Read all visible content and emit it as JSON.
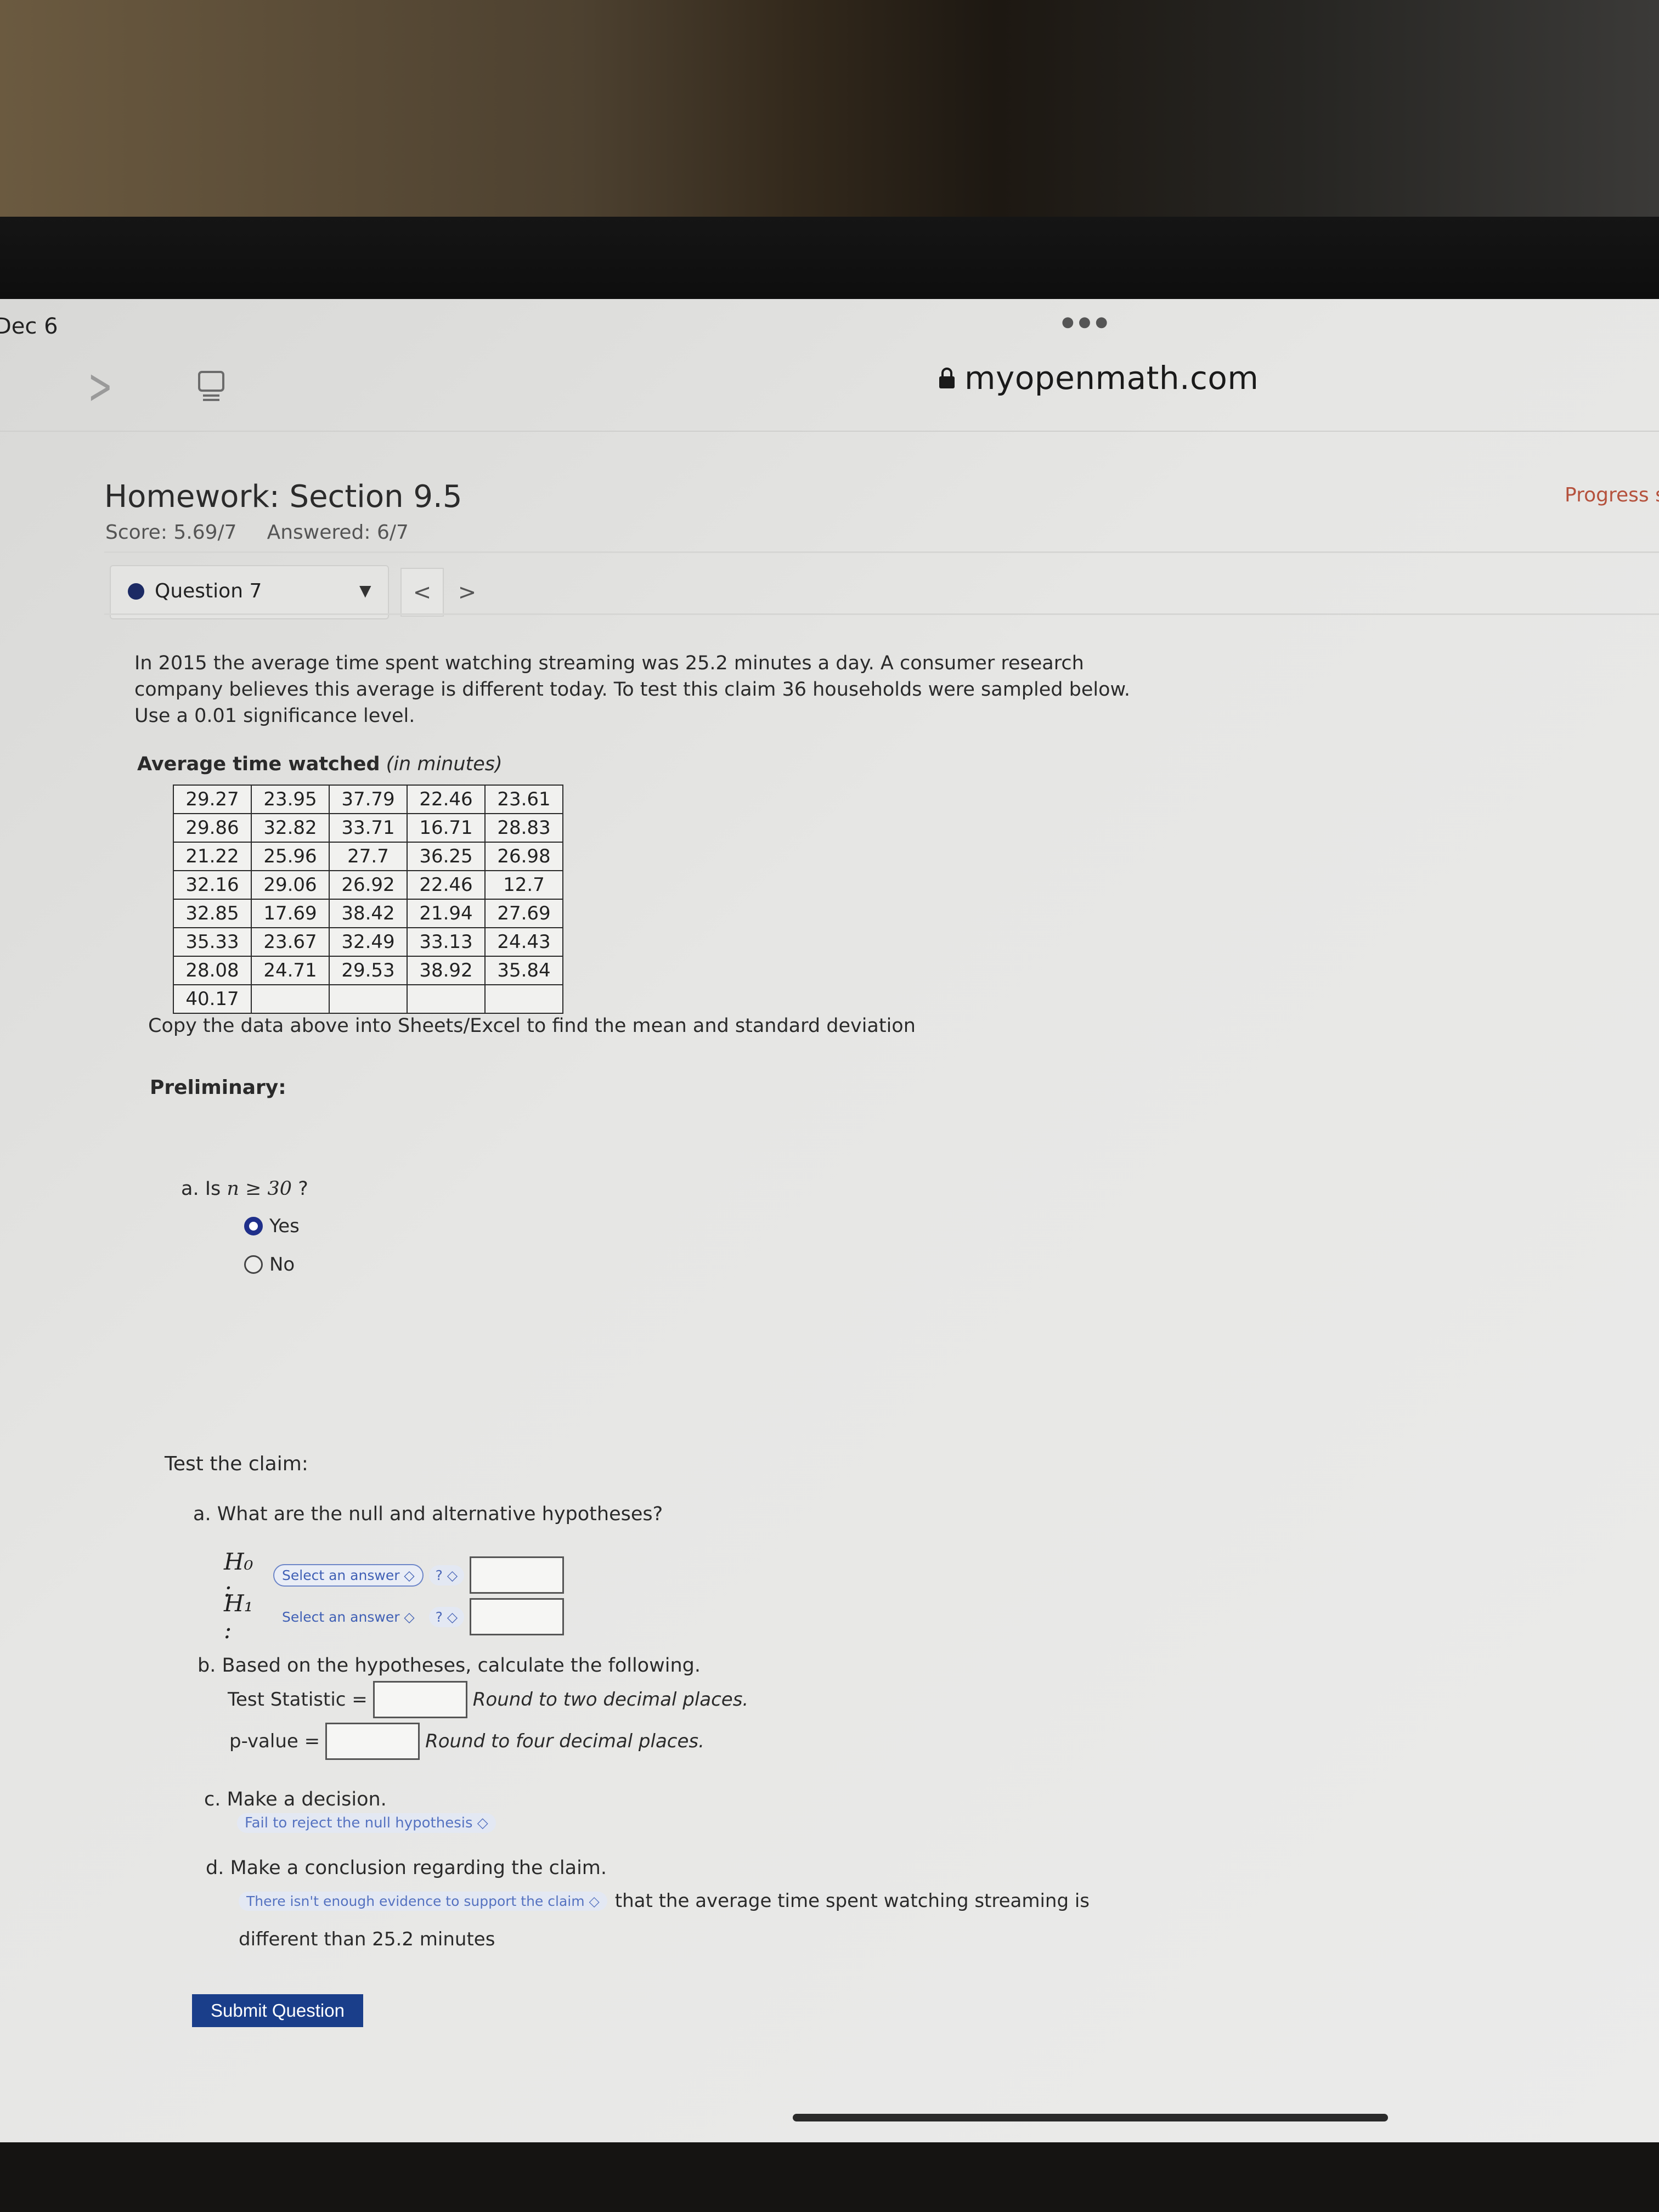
{
  "device": {
    "date": "Dec 6"
  },
  "browser": {
    "url": "myopenmath.com"
  },
  "assignment": {
    "title": "Homework: Section 9.5",
    "score": "Score: 5.69/7",
    "answered": "Answered: 6/7",
    "progress_note": "Progress sa"
  },
  "question_nav": {
    "label": "Question 7",
    "prev": "<",
    "next": ">"
  },
  "problem": {
    "prompt": "In 2015 the average time spent watching streaming was 25.2 minutes a day. A consumer research company believes this average is different today. To test this claim 36 households were sampled below. Use a 0.01 significance level.",
    "table_title_bold": "Average time watched",
    "table_title_italic": "(in minutes)",
    "table_rows": [
      [
        "29.27",
        "23.95",
        "37.79",
        "22.46",
        "23.61"
      ],
      [
        "29.86",
        "32.82",
        "33.71",
        "16.71",
        "28.83"
      ],
      [
        "21.22",
        "25.96",
        "27.7",
        "36.25",
        "26.98"
      ],
      [
        "32.16",
        "29.06",
        "26.92",
        "22.46",
        "12.7"
      ],
      [
        "32.85",
        "17.69",
        "38.42",
        "21.94",
        "27.69"
      ],
      [
        "35.33",
        "23.67",
        "32.49",
        "33.13",
        "24.43"
      ],
      [
        "28.08",
        "24.71",
        "29.53",
        "38.92",
        "35.84"
      ],
      [
        "40.17",
        "",
        "",
        "",
        ""
      ]
    ],
    "copy_note": "Copy the data above into Sheets/Excel to find the mean and standard deviation"
  },
  "preliminary": {
    "heading": "Preliminary:",
    "a_prefix": "a. Is",
    "a_math": "n ≥ 30",
    "a_suffix": "?",
    "options": [
      "Yes",
      "No"
    ],
    "selected": "Yes"
  },
  "test_claim": {
    "heading": "Test the claim:",
    "a_question": "a. What are the null and alternative hypotheses?",
    "h0_label": "H₀ :",
    "h1_label": "H₁ :",
    "select_placeholder": "Select an answer ◇",
    "op_placeholder": "? ◇",
    "b_question": "b. Based on the hypotheses, calculate the following.",
    "test_stat_label": "Test Statistic =",
    "test_stat_round": "Round to two decimal places.",
    "pvalue_label": "p-value =",
    "pvalue_round": "Round to four decimal places.",
    "c_question": "c. Make a decision.",
    "c_answer": "Fail to reject the null hypothesis ◇",
    "d_question": "d. Make a conclusion regarding the claim.",
    "d_answer": "There isn't enough evidence to support the claim ◇",
    "d_text_1": "that the average time spent watching streaming is",
    "d_text_2": "different than 25.2 minutes"
  },
  "actions": {
    "submit": "Submit Question"
  }
}
